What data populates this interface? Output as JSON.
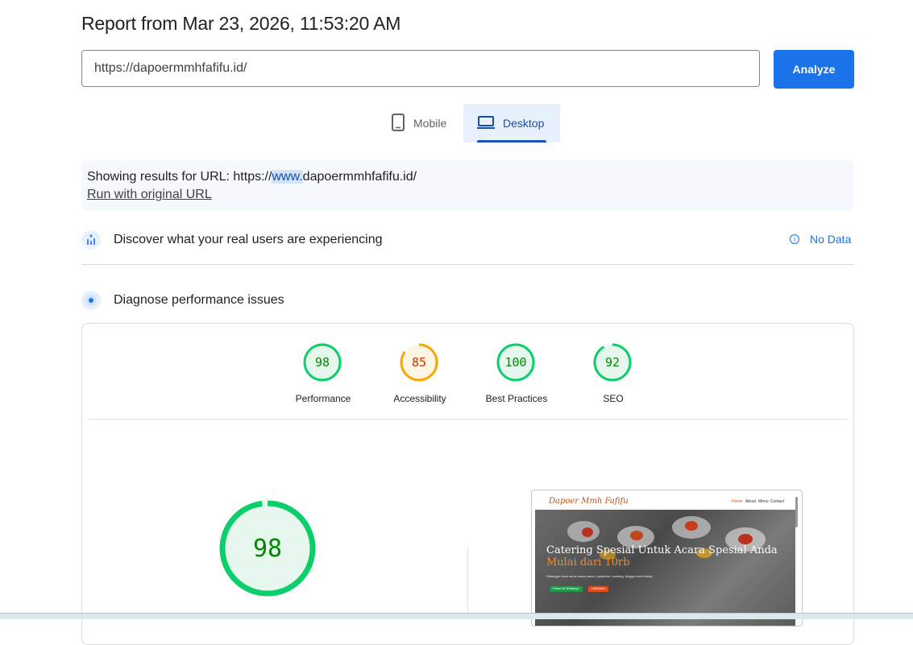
{
  "report": {
    "title": "Report from Mar 23, 2026, 11:53:20 AM"
  },
  "url_input": {
    "value": "https://dapoermmhfafifu.id/",
    "placeholder": ""
  },
  "analyze_button": {
    "label": "Analyze"
  },
  "device_tabs": {
    "mobile": "Mobile",
    "desktop": "Desktop",
    "selected": "Desktop"
  },
  "notice": {
    "prefix": "Showing results for URL: https://",
    "highlight": "www.",
    "suffix": "dapoermmhfafifu.id/",
    "link": "Run with original URL"
  },
  "real_users": {
    "title": "Discover what your real users are experiencing",
    "status": "No Data"
  },
  "diagnose": {
    "title": "Diagnose performance issues"
  },
  "scores": [
    {
      "value": "98",
      "label": "Performance",
      "status": "pass"
    },
    {
      "value": "85",
      "label": "Accessibility",
      "status": "average"
    },
    {
      "value": "100",
      "label": "Best Practices",
      "status": "pass"
    },
    {
      "value": "92",
      "label": "SEO",
      "status": "pass"
    }
  ],
  "big_score": {
    "value": "98"
  },
  "screenshot": {
    "brand": "Dapoer Mmh Fafifu",
    "nav": [
      "Home",
      "About",
      "Menu",
      "Contact"
    ],
    "headline": "Catering Spesial Untuk Acara Spesial Anda",
    "headline_accent": "Mulai dari 10rb",
    "subtext": "Hidangan lezat untuk acara kantor, syukuran, meeting, hingga event besar.",
    "buttons": [
      "Pesan via WhatsApp",
      "Lihat Menu"
    ]
  },
  "colors": {
    "accent": "#1a73e8",
    "pass": "#0cce6b",
    "pass_text": "#008800",
    "average": "#ffa400",
    "average_text": "#c33300"
  }
}
